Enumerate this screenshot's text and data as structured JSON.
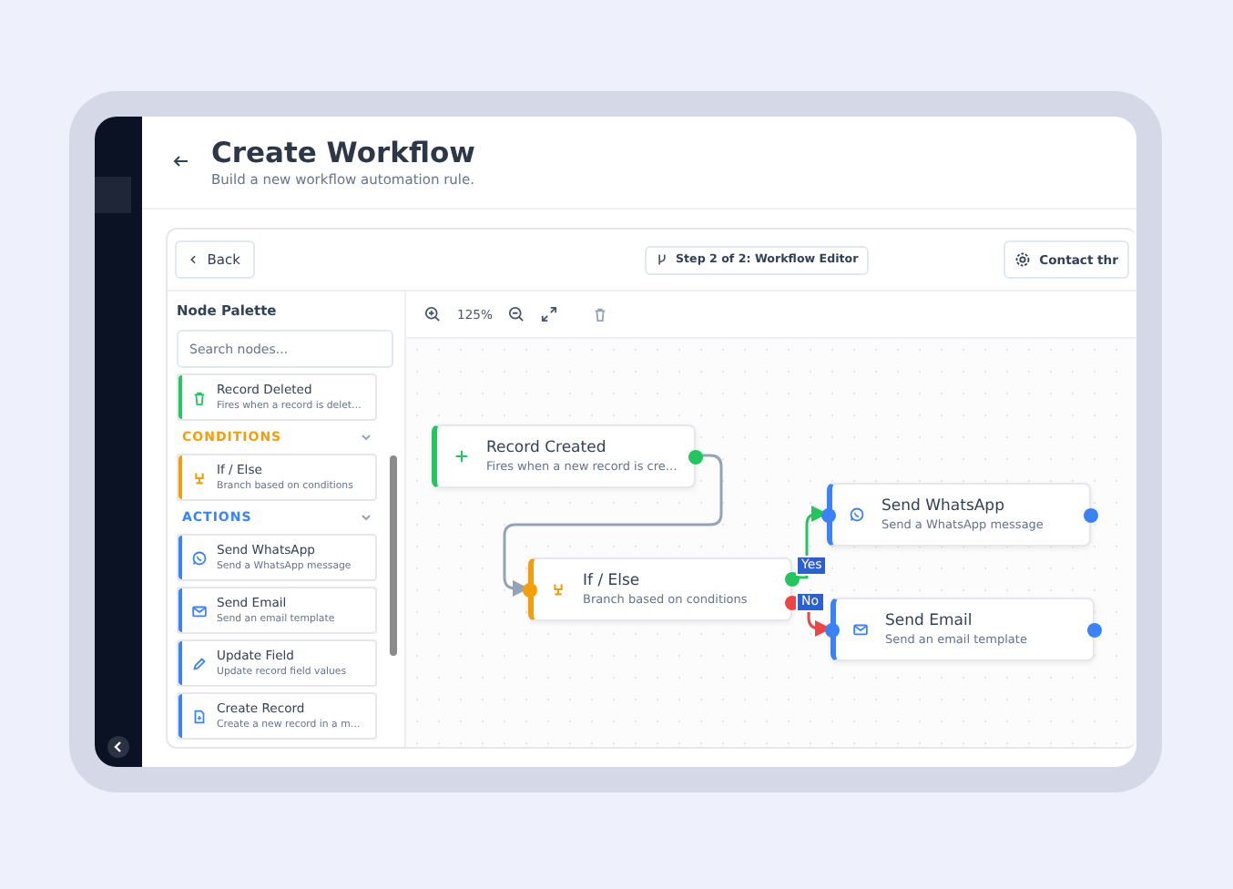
{
  "header": {
    "title": "Create Workflow",
    "subtitle": "Build a new workflow automation rule."
  },
  "toolbar": {
    "back": "Back",
    "step": "Step 2 of 2: Workflow Editor",
    "contact": "Contact thr"
  },
  "palette": {
    "title": "Node Palette",
    "placeholder": "Search nodes...",
    "sections": [
      {
        "color": "#22c55e",
        "items": [
          {
            "title": "Record Deleted",
            "desc": "Fires when a record is delet…"
          }
        ]
      },
      {
        "label": "CONDITIONS",
        "color": "#f59e0b",
        "expanded": true,
        "items": [
          {
            "title": "If / Else",
            "desc": "Branch based on conditions"
          }
        ]
      },
      {
        "label": "ACTIONS",
        "color": "#3b82f6",
        "expanded": true,
        "items": [
          {
            "title": "Send WhatsApp",
            "desc": "Send a WhatsApp message"
          },
          {
            "title": "Send Email",
            "desc": "Send an email template"
          },
          {
            "title": "Update Field",
            "desc": "Update record field values"
          },
          {
            "title": "Create Record",
            "desc": "Create a new record in a m…"
          }
        ]
      }
    ]
  },
  "canvas": {
    "zoom": "125%",
    "nodes": [
      {
        "kind": "trigger",
        "title": "Record Created",
        "desc": "Fires when a new record is cre…"
      },
      {
        "kind": "condition",
        "title": "If / Else",
        "desc": "Branch based on conditions"
      },
      {
        "kind": "action",
        "title": "Send WhatsApp",
        "desc": "Send a WhatsApp message"
      },
      {
        "kind": "action",
        "title": "Send Email",
        "desc": "Send an email template"
      }
    ],
    "branches": [
      "Yes",
      "No"
    ]
  }
}
